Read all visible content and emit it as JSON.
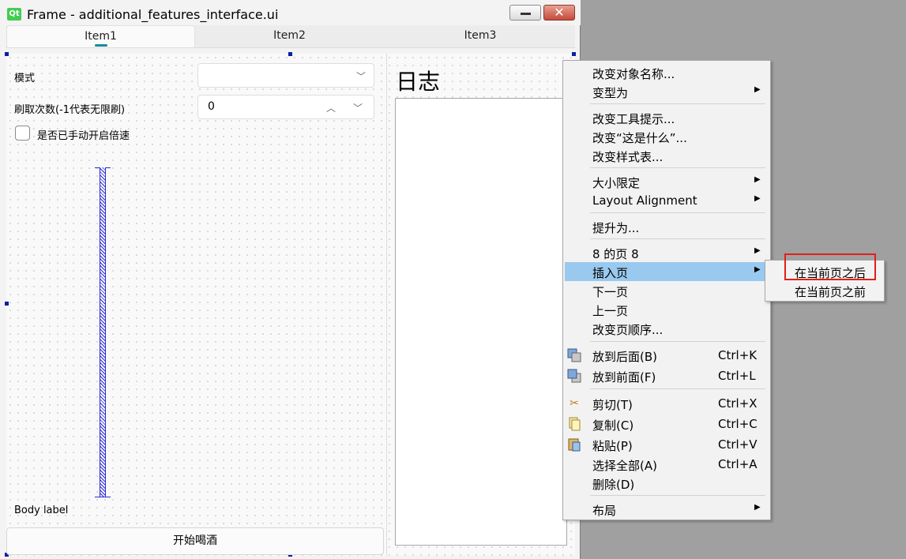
{
  "window": {
    "title": "Frame - additional_features_interface.ui",
    "logo": "Qt"
  },
  "tabs": [
    {
      "label": "Item1",
      "active": true
    },
    {
      "label": "Item2",
      "active": false
    },
    {
      "label": "Item3",
      "active": false
    }
  ],
  "form": {
    "mode_label": "模式",
    "mode_value": "",
    "count_label": "刷取次数(-1代表无限刷)",
    "count_value": "0",
    "checkbox_label": "是否已手动开启倍速",
    "body_label": "Body label",
    "start_button": "开始喝酒"
  },
  "log": {
    "title": "日志"
  },
  "context_menu": {
    "items": [
      {
        "label": "改变对象名称...",
        "submenu": false
      },
      {
        "label": "变型为",
        "submenu": true
      },
      {
        "label": "改变工具提示...",
        "submenu": false
      },
      {
        "label": "改变“这是什么”...",
        "submenu": false
      },
      {
        "label": "改变样式表...",
        "submenu": false
      },
      {
        "label": "大小限定",
        "submenu": true
      },
      {
        "label": "Layout Alignment",
        "submenu": true
      },
      {
        "label": "提升为...",
        "submenu": false
      },
      {
        "label": "8 的页 8",
        "submenu": true
      },
      {
        "label": "插入页",
        "submenu": true,
        "highlighted": true
      },
      {
        "label": "下一页",
        "submenu": false
      },
      {
        "label": "上一页",
        "submenu": false
      },
      {
        "label": "改变页顺序...",
        "submenu": false
      },
      {
        "label": "放到后面(B)",
        "shortcut": "Ctrl+K",
        "icon": "send-back-icon"
      },
      {
        "label": "放到前面(F)",
        "shortcut": "Ctrl+L",
        "icon": "bring-front-icon"
      },
      {
        "label": "剪切(T)",
        "shortcut": "Ctrl+X",
        "icon": "scissors-icon"
      },
      {
        "label": "复制(C)",
        "shortcut": "Ctrl+C",
        "icon": "copy-icon"
      },
      {
        "label": "粘贴(P)",
        "shortcut": "Ctrl+V",
        "icon": "paste-icon"
      },
      {
        "label": "选择全部(A)",
        "shortcut": "Ctrl+A"
      },
      {
        "label": "删除(D)"
      },
      {
        "label": "布局",
        "submenu": true
      }
    ]
  },
  "submenu": {
    "items": [
      {
        "label": "在当前页之后",
        "outlined": true
      },
      {
        "label": "在当前页之前"
      }
    ]
  },
  "colors": {
    "menu_highlight": "#99c9ef",
    "outline_red": "#e0201a",
    "tab_indicator": "#1a8a9a",
    "spacer_blue": "#2b2bd6",
    "qt_green": "#41cd52"
  }
}
